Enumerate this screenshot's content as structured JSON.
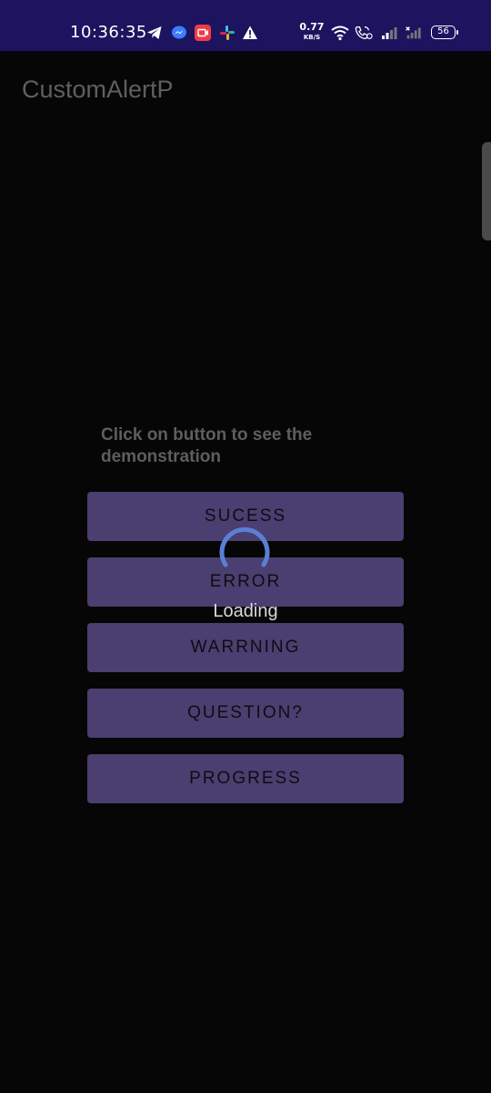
{
  "status_bar": {
    "time": "10:36:35",
    "net_speed_value": "0.77",
    "net_speed_unit": "KB/S",
    "battery": "56",
    "icons": [
      "telegram-icon",
      "messenger-icon",
      "screen-record-icon",
      "slack-icon",
      "warning-icon",
      "wifi-icon",
      "volte-call-icon",
      "signal-icon",
      "no-signal-icon"
    ]
  },
  "app_bar": {
    "title": "CustomAlertP"
  },
  "main": {
    "instruction": "Click on button to see the demonstration",
    "buttons": {
      "success": "SUCESS",
      "error": "ERROR",
      "warning": "WARRNING",
      "question": "QUESTION?",
      "progress": "PROGRESS"
    }
  },
  "loading_overlay": {
    "label": "Loading"
  },
  "colors": {
    "status_bar_bg": "#1d1460",
    "screen_bg": "#060606",
    "button_bg": "#4b3e70",
    "spinner": "#5b7fd4"
  }
}
